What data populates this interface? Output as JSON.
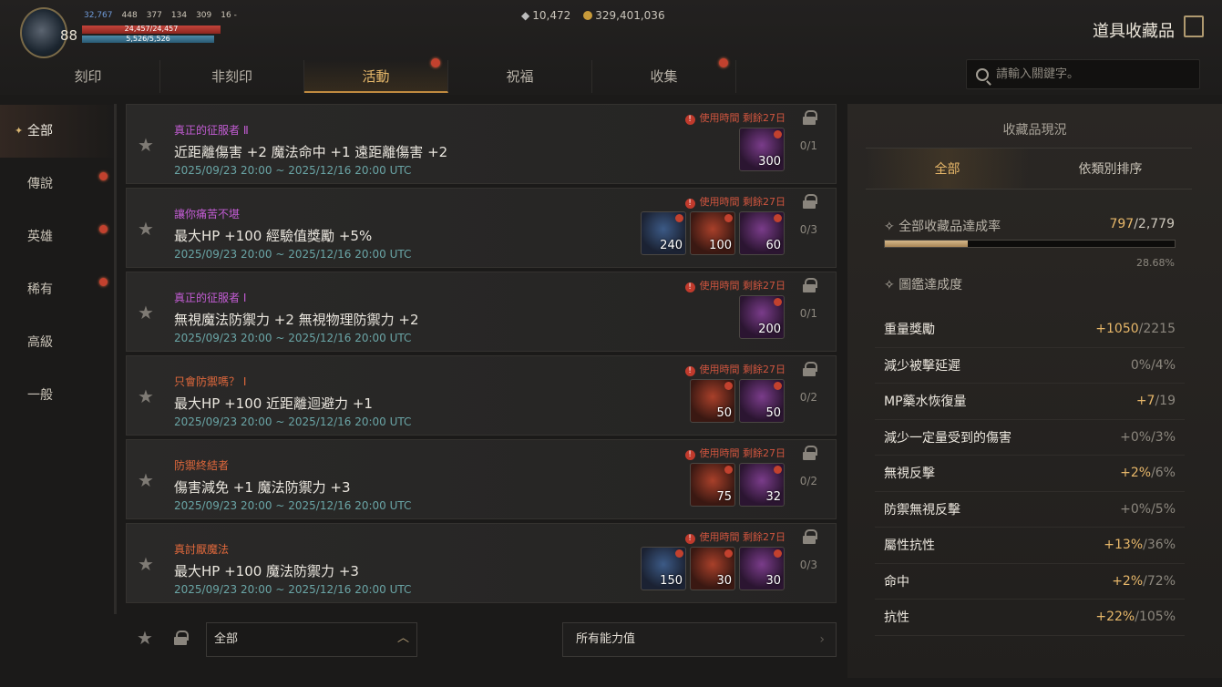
{
  "player": {
    "level": "88",
    "stat1": "32,767",
    "stat2": "448",
    "stat3": "377",
    "stat4": "134",
    "stat5": "309",
    "stat6": "16 -",
    "hp": "24,457/24,457",
    "mp": "5,526/5,526"
  },
  "currency": {
    "gems": "10,472",
    "gold": "329,401,036"
  },
  "page_title": "道具收藏品",
  "tabs": [
    {
      "label": "刻印"
    },
    {
      "label": "非刻印"
    },
    {
      "label": "活動"
    },
    {
      "label": "祝福"
    },
    {
      "label": "收集"
    }
  ],
  "search": {
    "placeholder": "請輸入關鍵字。"
  },
  "sidebar": [
    {
      "label": "全部"
    },
    {
      "label": "傳說"
    },
    {
      "label": "英雄"
    },
    {
      "label": "稀有"
    },
    {
      "label": "高級"
    },
    {
      "label": "一般"
    }
  ],
  "warning_text": "使用時間 剩餘27日",
  "rows": [
    {
      "name": "真正的征服者 Ⅱ",
      "name_color": "#c35cd4",
      "desc": "近距離傷害 +2 魔法命中 +1 遠距離傷害 +2",
      "date": "2025/09/23 20:00 ~ 2025/12/16 20:00 UTC",
      "count": "0/1",
      "items": [
        {
          "type": "purple",
          "n": "300"
        }
      ]
    },
    {
      "name": "讓你痛苦不堪",
      "name_color": "#c35cd4",
      "desc": "最大HP +100 經驗值獎勵 +5%",
      "date": "2025/09/23 20:00 ~ 2025/12/16 20:00 UTC",
      "count": "0/3",
      "items": [
        {
          "type": "blue",
          "n": "240"
        },
        {
          "type": "red",
          "n": "100"
        },
        {
          "type": "purple",
          "n": "60"
        }
      ]
    },
    {
      "name": "真正的征服者 Ⅰ",
      "name_color": "#c35cd4",
      "desc": "無視魔法防禦力 +2 無視物理防禦力 +2",
      "date": "2025/09/23 20:00 ~ 2025/12/16 20:00 UTC",
      "count": "0/1",
      "items": [
        {
          "type": "purple",
          "n": "200"
        }
      ]
    },
    {
      "name": "只會防禦嗎？ Ⅰ",
      "name_color": "#e0683c",
      "desc": "最大HP +100 近距離迴避力 +1",
      "date": "2025/09/23 20:00 ~ 2025/12/16 20:00 UTC",
      "count": "0/2",
      "items": [
        {
          "type": "red",
          "n": "50"
        },
        {
          "type": "purple",
          "n": "50"
        }
      ]
    },
    {
      "name": "防禦終結者",
      "name_color": "#e0683c",
      "desc": "傷害減免 +1 魔法防禦力 +3",
      "date": "2025/09/23 20:00 ~ 2025/12/16 20:00 UTC",
      "count": "0/2",
      "items": [
        {
          "type": "red",
          "n": "75"
        },
        {
          "type": "purple",
          "n": "32"
        }
      ]
    },
    {
      "name": "真討厭魔法",
      "name_color": "#e0683c",
      "desc": "最大HP +100 魔法防禦力 +3",
      "date": "2025/09/23 20:00 ~ 2025/12/16 20:00 UTC",
      "count": "0/3",
      "items": [
        {
          "type": "blue",
          "n": "150"
        },
        {
          "type": "red",
          "n": "30"
        },
        {
          "type": "purple",
          "n": "30"
        }
      ]
    }
  ],
  "bottom": {
    "filter": "全部",
    "ability": "所有能力值"
  },
  "panel": {
    "title": "收藏品現況",
    "tab_all": "全部",
    "tab_sort": "依類別排序",
    "rate_label": "全部收藏品達成率",
    "rate_current": "797",
    "rate_total": "/2,779",
    "rate_fraction": 0.2868,
    "rate_pct": "28.68%",
    "dex_label": "圖鑑達成度",
    "stats": [
      {
        "label": "重量獎勵",
        "plus": "+1050",
        "total": "/2215"
      },
      {
        "label": "減少被擊延遲",
        "plus": "",
        "total": "0%/4%"
      },
      {
        "label": "MP藥水恢復量",
        "plus": "+7",
        "total": "/19"
      },
      {
        "label": "減少一定量受到的傷害",
        "plus": "",
        "total": "+0%/3%"
      },
      {
        "label": "無視反擊",
        "plus": "+2%",
        "total": "/6%"
      },
      {
        "label": "防禦無視反擊",
        "plus": "",
        "total": "+0%/5%"
      },
      {
        "label": "屬性抗性",
        "plus": "+13%",
        "total": "/36%"
      },
      {
        "label": "命中",
        "plus": "+2%",
        "total": "/72%"
      },
      {
        "label": "抗性",
        "plus": "+22%",
        "total": "/105%"
      }
    ]
  }
}
